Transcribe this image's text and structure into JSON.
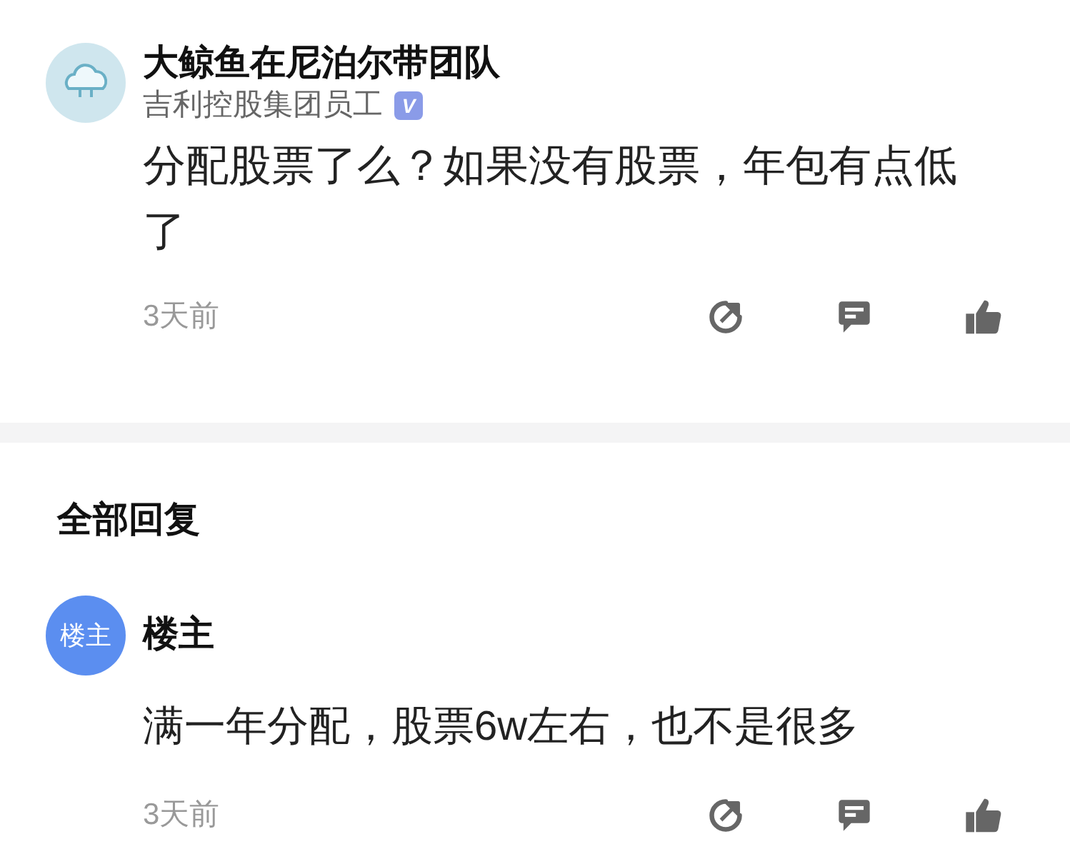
{
  "post": {
    "author": "大鲸鱼在尼泊尔带团队",
    "company": "吉利控股集团员工",
    "verified": true,
    "badge": "V",
    "text": "分配股票了么？如果没有股票，年包有点低了",
    "time": "3天前"
  },
  "replies_heading": "全部回复",
  "replies": [
    {
      "avatar_text": "楼主",
      "author": "楼主",
      "text": "满一年分配，股票6w左右，也不是很多",
      "time": "3天前"
    }
  ]
}
